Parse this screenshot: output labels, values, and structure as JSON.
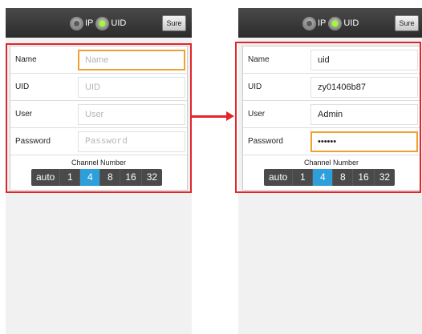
{
  "left_screen": {
    "radio_ip_label": "IP",
    "radio_uid_label": "UID",
    "sure_label": "Sure",
    "fields": [
      {
        "label": "Name",
        "placeholder": "Name",
        "value": ""
      },
      {
        "label": "UID",
        "placeholder": "UID",
        "value": ""
      },
      {
        "label": "User",
        "placeholder": "User",
        "value": ""
      },
      {
        "label": "Password",
        "placeholder": "Password",
        "value": ""
      }
    ],
    "channel_title": "Channel Number",
    "channels": [
      "auto",
      "1",
      "4",
      "8",
      "16",
      "32"
    ],
    "selected_channel": "4"
  },
  "right_screen": {
    "radio_ip_label": "IP",
    "radio_uid_label": "UID",
    "sure_label": "Sure",
    "fields": [
      {
        "label": "Name",
        "placeholder": "",
        "value": "uid"
      },
      {
        "label": "UID",
        "placeholder": "",
        "value": "zy01406b87"
      },
      {
        "label": "User",
        "placeholder": "",
        "value": "Admin"
      },
      {
        "label": "Password",
        "placeholder": "",
        "value": "••••••"
      }
    ],
    "channel_title": "Channel Number",
    "channels": [
      "auto",
      "1",
      "4",
      "8",
      "16",
      "32"
    ],
    "selected_channel": "4"
  },
  "colors": {
    "highlight": "#e0262b",
    "selected_segment": "#2f9fdc",
    "focus_border": "#f0a030",
    "radio_on": "#9cff2e"
  }
}
